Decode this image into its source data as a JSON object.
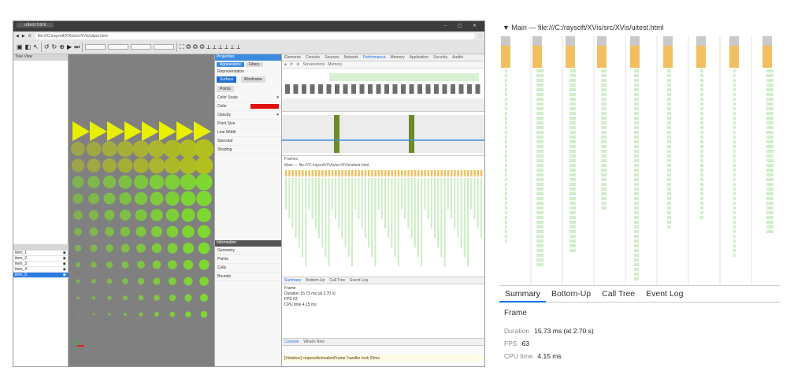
{
  "left_window": {
    "tab_title": "uitest.html",
    "window_controls": "– ▢ ✕",
    "address": "file:///C:/raysoft/XVis/src/XVis/uitest.html",
    "toolbar_icons": [
      "folder-open-icon",
      "save-icon",
      "pointer-icon",
      "rotate-left-icon",
      "rotate-right-icon",
      "zoom-icon",
      "play-icon",
      "step-icon"
    ],
    "left_view_header": "Tree View",
    "list_items": [
      "item_1",
      "item_2",
      "item_3",
      "item_4",
      "item_5"
    ],
    "props_header": "Properties",
    "props_tabs": [
      "Appearance",
      "Filters"
    ],
    "props_section": "Representation",
    "props_buttons": [
      "Surface",
      "Wireframe",
      "Points"
    ],
    "props_fields": [
      "Color Scale",
      "Color",
      "Opacity",
      "Point Size",
      "Line Width",
      "Specular",
      "Shading"
    ],
    "props_lower_header": "Information",
    "props_lower_items": [
      "Geometry",
      "Points",
      "Cells",
      "Bounds"
    ]
  },
  "devtools": {
    "tabs": [
      "Elements",
      "Console",
      "Sources",
      "Network",
      "Performance",
      "Memory",
      "Application",
      "Security",
      "Audits"
    ],
    "active_tab": "Performance",
    "controls": [
      "Record",
      "Reload",
      "Clear",
      "Screenshots",
      "Memory"
    ],
    "frames_label": "Frames",
    "main_label": "Main — file:///C:/raysoft/XVis/src/XVis/uitest.html",
    "bottom_tabs": [
      "Summary",
      "Bottom-Up",
      "Call Tree",
      "Event Log"
    ],
    "summary_lines": [
      "Frame",
      "Duration 15.73 ms (at 2.70 s)",
      "FPS 63",
      "CPU time 4.15 ms"
    ],
    "console_tabs": [
      "Console",
      "What's New"
    ],
    "console_warning": "[Violation] 'requestAnimationFrame' handler took 50ms"
  },
  "zoom_panel": {
    "main_title": "▼ Main — file:///C:/raysoft/XVis/src/XVis/uitest.html",
    "tabs": [
      "Summary",
      "Bottom-Up",
      "Call Tree",
      "Event Log"
    ],
    "active_tab": "Summary",
    "summary_heading": "Frame",
    "rows": [
      {
        "label": "Duration",
        "value": "15.73 ms (at 2.70 s)"
      },
      {
        "label": "FPS",
        "value": "63"
      },
      {
        "label": "CPU time",
        "value": "4.15 ms"
      }
    ]
  },
  "colors": {
    "accent": "#1a73e8",
    "flame_scripting": "#f0c060",
    "flame_paint": "#a8e29c",
    "task_grey": "#c9c9c9",
    "cone_yellow": "#e8f000",
    "sphere_green": "#7edc2c"
  }
}
